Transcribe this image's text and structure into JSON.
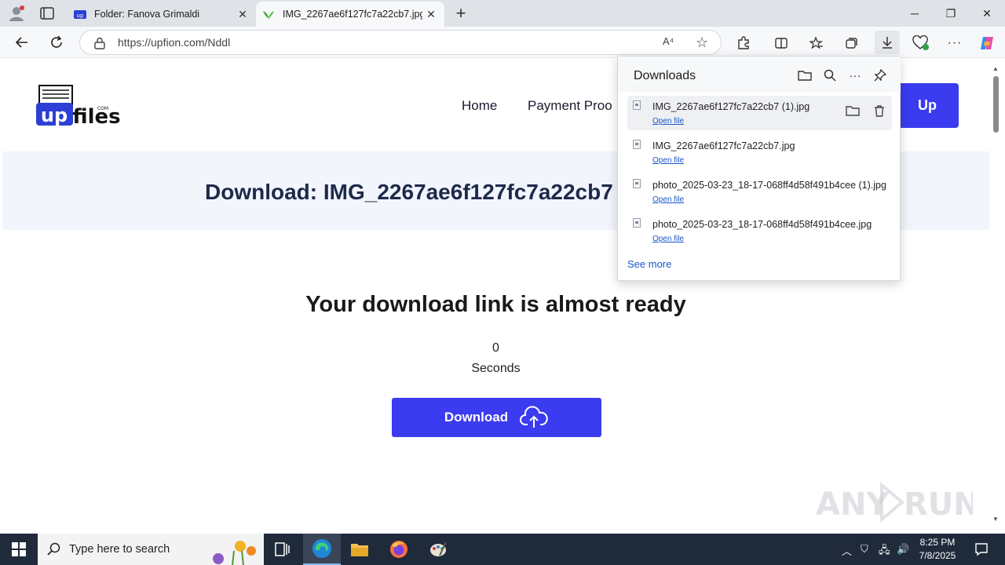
{
  "tabs": [
    {
      "title": "Folder: Fanova Grimaldi"
    },
    {
      "title": "IMG_2267ae6f127fc7a22cb7.jpg"
    }
  ],
  "toolbar": {
    "url": "https://upfion.com/Nddl",
    "read_aloud": "A⁴"
  },
  "site": {
    "logo_text": "upfiles",
    "logo_small": "COM",
    "nav": {
      "home": "Home",
      "payment": "Payment Proo"
    },
    "signup_label": "Up",
    "banner_title": "Download: IMG_2267ae6f127fc7a22cb7",
    "ready_heading": "Your download link is almost ready",
    "countdown_value": "0",
    "countdown_unit": "Seconds",
    "download_button": "Download"
  },
  "downloads": {
    "title": "Downloads",
    "items": [
      {
        "name": "IMG_2267ae6f127fc7a22cb7 (1).jpg",
        "link": "Open file"
      },
      {
        "name": "IMG_2267ae6f127fc7a22cb7.jpg",
        "link": "Open file"
      },
      {
        "name": "photo_2025-03-23_18-17-068ff4d58f491b4cee (1).jpg",
        "link": "Open file"
      },
      {
        "name": "photo_2025-03-23_18-17-068ff4d58f491b4cee.jpg",
        "link": "Open file"
      }
    ],
    "see_more": "See more"
  },
  "taskbar": {
    "search_placeholder": "Type here to search",
    "time": "8:25 PM",
    "date": "7/8/2025"
  },
  "watermark": "ANY RUN",
  "colors": {
    "accent": "#3b3bf0",
    "link": "#1a56c6",
    "taskbar": "#1f2a3a"
  }
}
